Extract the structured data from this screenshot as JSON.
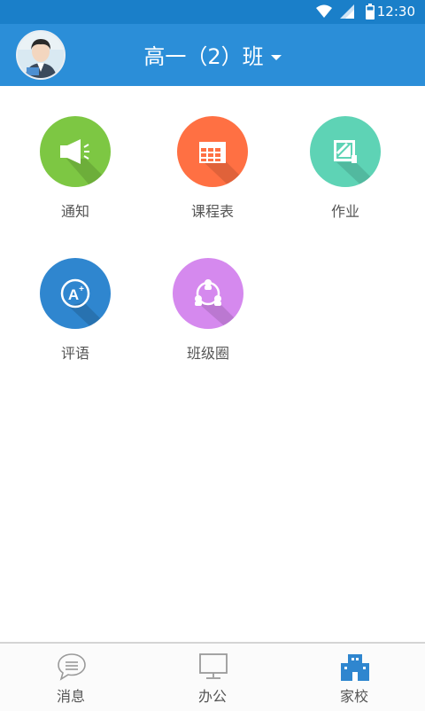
{
  "status_bar": {
    "time": "12:30"
  },
  "header": {
    "title": "高一（2）班"
  },
  "grid": {
    "items": [
      {
        "label": "通知",
        "color": "#7dc743"
      },
      {
        "label": "课程表",
        "color": "#ff7043"
      },
      {
        "label": "作业",
        "color": "#5ed3b5"
      },
      {
        "label": "评语",
        "color": "#2f86cf"
      },
      {
        "label": "班级圈",
        "color": "#d589ee"
      }
    ]
  },
  "bottom_nav": {
    "items": [
      {
        "label": "消息",
        "active": false
      },
      {
        "label": "办公",
        "active": false
      },
      {
        "label": "家校",
        "active": true
      }
    ]
  },
  "colors": {
    "primary": "#2b8ed8",
    "status": "#1a7fc9",
    "active_nav": "#2f86cf"
  }
}
